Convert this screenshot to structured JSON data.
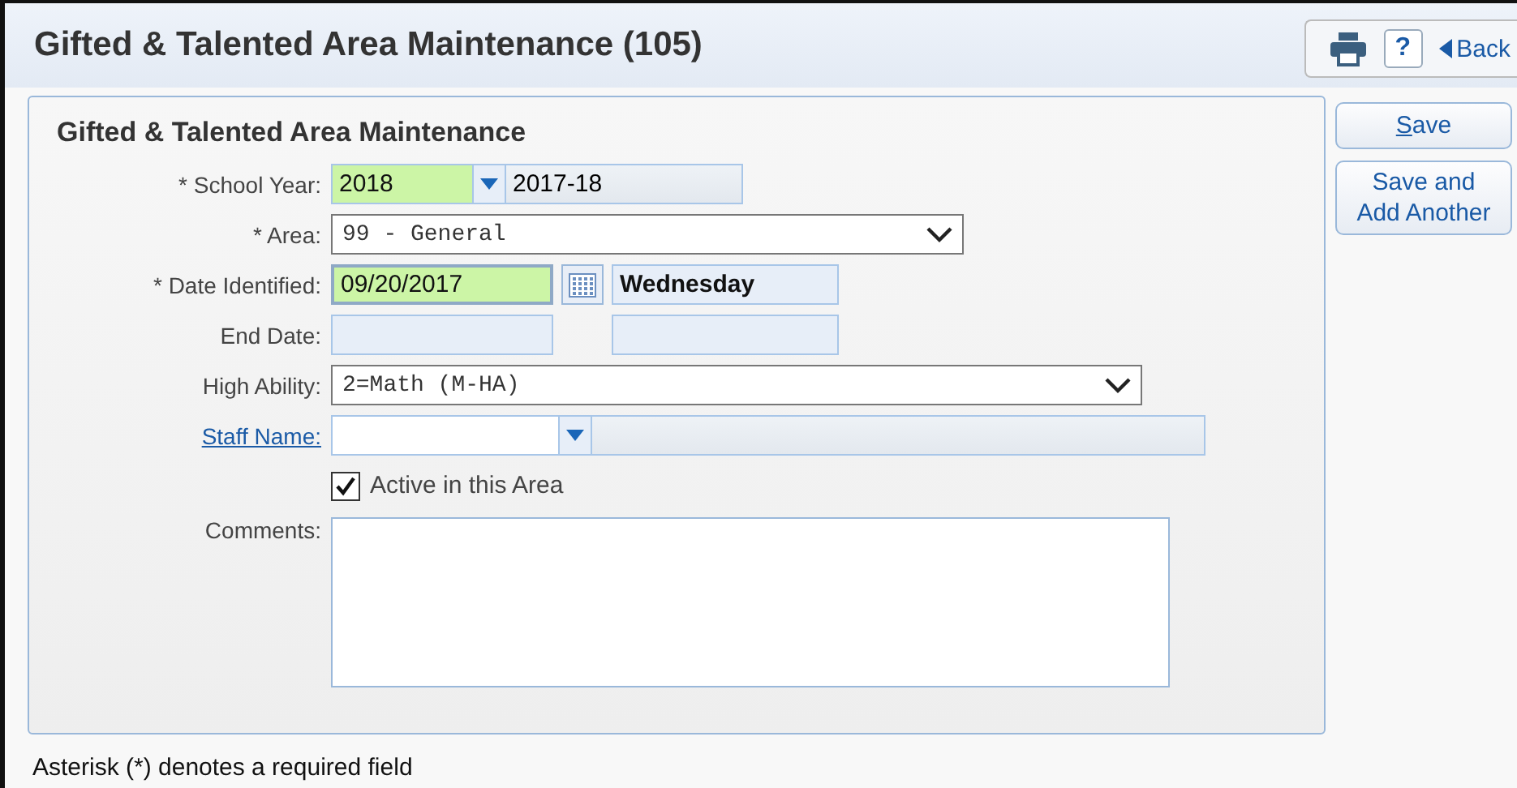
{
  "header": {
    "title": "Gifted & Talented Area Maintenance (105)",
    "toolbar": {
      "help": "?",
      "back": "Back"
    }
  },
  "panel": {
    "title": "Gifted & Talented Area Maintenance",
    "fields": [
      {
        "kind": "lookup",
        "label": "* School Year:",
        "value": "2018",
        "description": "2017-18",
        "highlighted": true
      },
      {
        "kind": "select",
        "label": "* Area:",
        "value": "99 - General"
      },
      {
        "kind": "date",
        "label": "* Date Identified:",
        "value": "09/20/2017",
        "day": "Wednesday",
        "highlighted": true
      },
      {
        "kind": "date",
        "label": "End Date:",
        "highlighted": false
      },
      {
        "kind": "wide_select",
        "label": "High Ability:",
        "value": "2=Math (M-HA)"
      },
      {
        "kind": "link_lookup",
        "label": "Staff Name:",
        "highlighted": false
      },
      {
        "kind": "checkbox",
        "label": "Active in this Area",
        "checked": true
      },
      {
        "kind": "textarea",
        "label": "Comments:"
      }
    ]
  },
  "actions": [
    {
      "label": "Save"
    },
    {
      "label": "Save and Add Another"
    }
  ],
  "footer": "Asterisk (*) denotes a required field"
}
